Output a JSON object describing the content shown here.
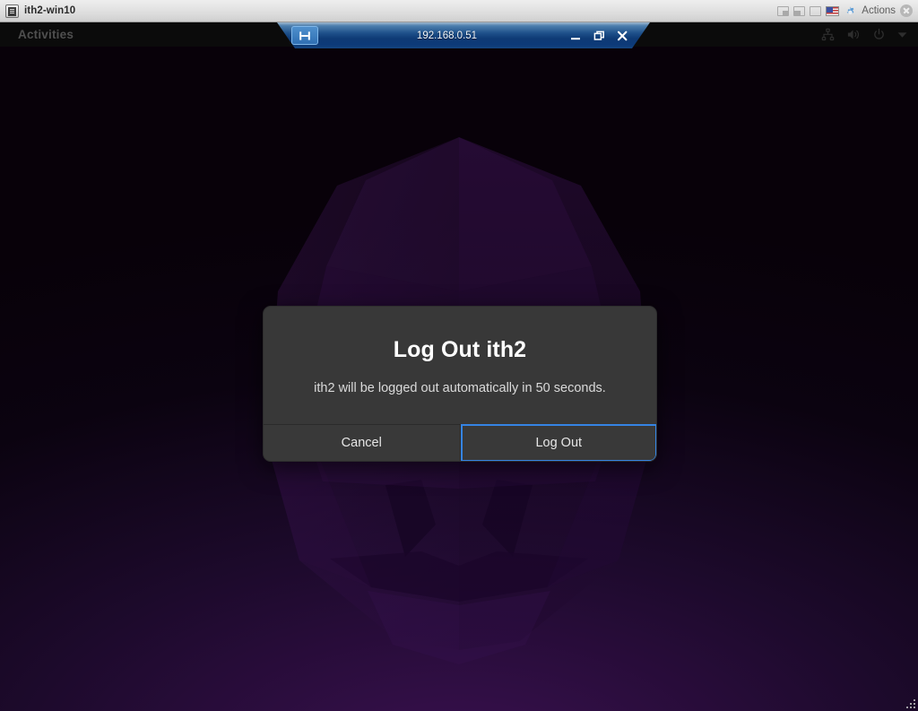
{
  "host_window": {
    "title": "ith2-win10",
    "app_icon": "terminal-window-icon",
    "tray": {
      "window_icons": [
        "window-restore-icon",
        "window-tile-icon",
        "window-maximize-icon"
      ],
      "keyboard_layout_icon": "us-flag-icon",
      "gear_icon": "gear-icon",
      "actions_label": "Actions",
      "close_icon": "close-icon"
    }
  },
  "remmina_toolbar": {
    "pin_icon": "toolbar-pin-icon",
    "host_label": "192.168.0.51",
    "minimize_icon": "minimize-icon",
    "restore_icon": "restore-icon",
    "close_icon": "close-icon"
  },
  "gnome_topbar": {
    "activities_label": "Activities",
    "status_icons": [
      "network-wired-icon",
      "volume-icon",
      "power-icon",
      "chevron-down-icon"
    ]
  },
  "logout_dialog": {
    "title": "Log Out ith2",
    "message": "ith2 will be logged out automatically in 50 seconds.",
    "cancel_label": "Cancel",
    "confirm_label": "Log Out",
    "countdown_seconds": "50",
    "username": "ith2",
    "focused_button": "Log Out"
  },
  "colors": {
    "dialog_background": "#383838",
    "dialog_button_background": "#393939",
    "focus_ring": "#3584e4",
    "toolbar_blue": "#0e3a75",
    "topbar_black": "#0b0b0b",
    "wallpaper_purple": "#2b0c3f",
    "host_chrome": "#e2e2e2"
  }
}
